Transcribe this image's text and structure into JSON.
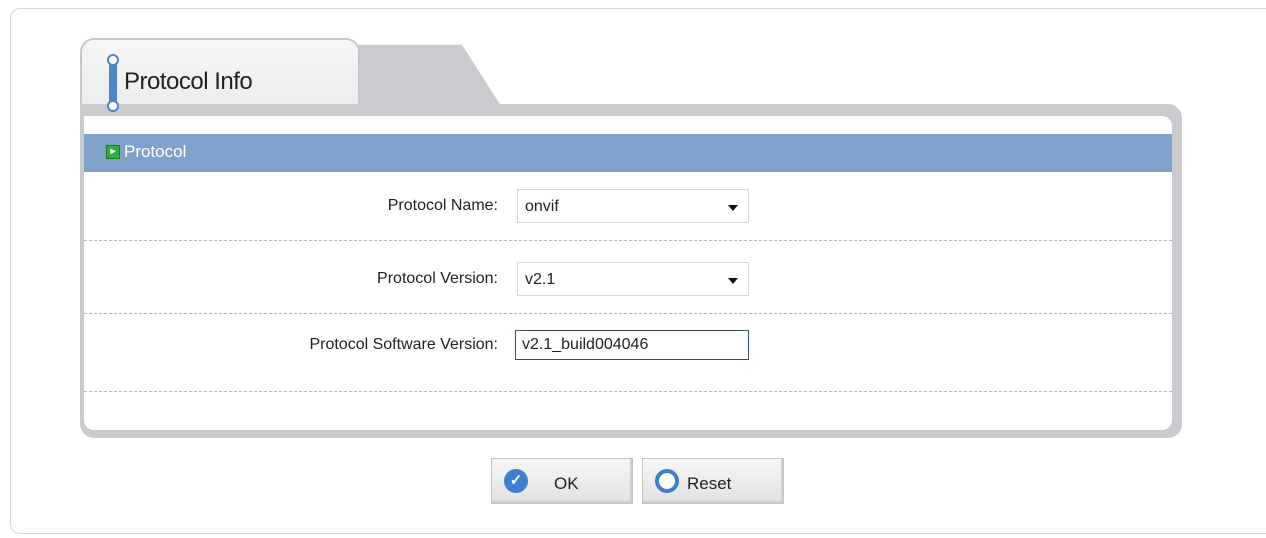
{
  "tab": {
    "title": "Protocol Info"
  },
  "section": {
    "title": "Protocol",
    "icon": "arrow-box-icon"
  },
  "fields": {
    "protocol_name": {
      "label": "Protocol Name:",
      "value": "onvif"
    },
    "protocol_version": {
      "label": "Protocol Version:",
      "value": "v2.1"
    },
    "protocol_software_version": {
      "label": "Protocol Software Version:",
      "value": "v2.1_build004046"
    }
  },
  "buttons": {
    "ok": {
      "label": "OK",
      "icon": "check-circle-icon"
    },
    "reset": {
      "label": "Reset",
      "icon": "ring-icon"
    }
  },
  "colors": {
    "accent": "#4f86c6",
    "header": "#7ea2cb",
    "panel": "#c9cbcf"
  }
}
